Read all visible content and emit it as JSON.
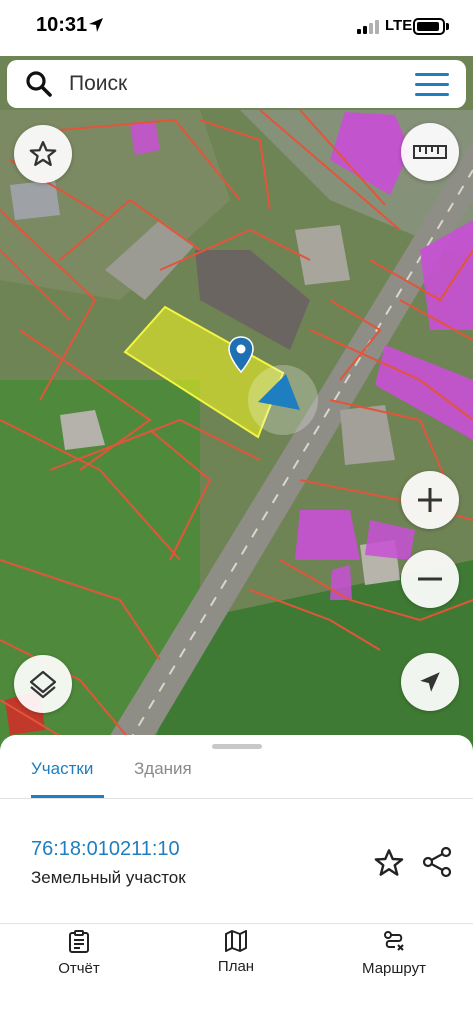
{
  "status_bar": {
    "time": "10:31",
    "network": "LTE"
  },
  "search": {
    "placeholder": "Поиск"
  },
  "tabs": [
    {
      "label": "Участки",
      "active": true
    },
    {
      "label": "Здания",
      "active": false
    }
  ],
  "parcel": {
    "id": "76:18:010211:10",
    "type": "Земельный участок"
  },
  "bottom_nav": [
    {
      "label": "Отчёт",
      "icon": "report-icon"
    },
    {
      "label": "План",
      "icon": "map-plan-icon"
    },
    {
      "label": "Маршрут",
      "icon": "route-icon"
    }
  ],
  "colors": {
    "accent": "#1f7ec0",
    "parcel_border": "#e2553a",
    "selected_parcel": "#e9ef22",
    "building_highlight": "#c94fd6"
  }
}
